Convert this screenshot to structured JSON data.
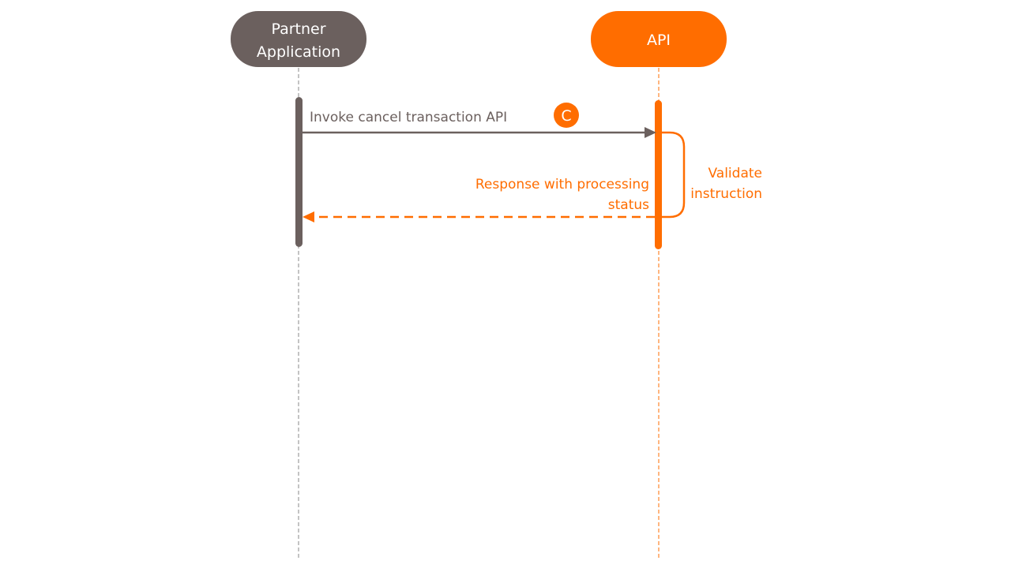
{
  "diagram": {
    "type": "sequence",
    "colors": {
      "partner": "#6b605e",
      "api": "#ff6d00",
      "lifeline_partner": "#8a8a8a",
      "lifeline_api": "#ff6d00"
    },
    "actors": [
      {
        "id": "partner",
        "label_lines": [
          "Partner",
          "Application"
        ]
      },
      {
        "id": "api",
        "label_lines": [
          "API"
        ]
      }
    ],
    "messages": [
      {
        "from": "partner",
        "to": "api",
        "style": "solid",
        "label": "Invoke cancel transaction API"
      },
      {
        "from": "api",
        "to": "partner",
        "style": "dashed",
        "label_lines": [
          "Response with processing",
          "status"
        ]
      }
    ],
    "self_note": {
      "actor": "api",
      "label_lines": [
        "Validate",
        "instruction"
      ]
    },
    "badge": {
      "letter": "C"
    }
  }
}
